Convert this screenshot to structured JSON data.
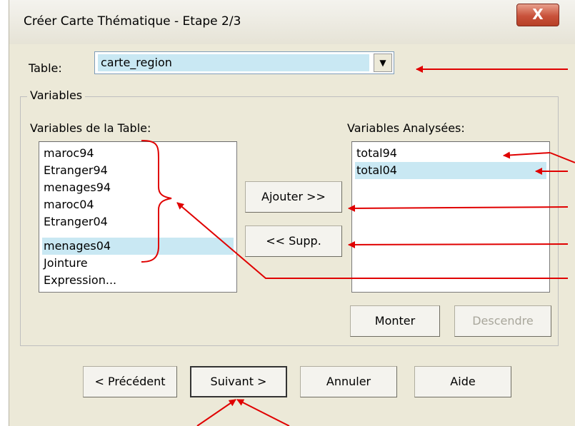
{
  "window": {
    "title": "Créer Carte Thématique - Etape 2/3",
    "close_label": "X"
  },
  "table": {
    "label": "Table:",
    "selected": "carte_region",
    "arrow": "▼"
  },
  "variables_group": {
    "legend": "Variables"
  },
  "source_list": {
    "label": "Variables de la Table:",
    "items": [
      "maroc94",
      "Etranger94",
      "menages94",
      "maroc04",
      "Etranger04",
      "menages04",
      "Jointure",
      "Expression..."
    ],
    "selected_index": 5
  },
  "target_list": {
    "label": "Variables Analysées:",
    "items": [
      "total94",
      "total04"
    ],
    "selected_index": 1
  },
  "buttons": {
    "add": "Ajouter >>",
    "remove": "<< Supp.",
    "up": "Monter",
    "down": "Descendre",
    "prev": "< Précédent",
    "next": "Suivant >",
    "cancel": "Annuler",
    "help": "Aide"
  },
  "colors": {
    "annotation": "#e00000",
    "selection": "#c9e8f3",
    "close_button": "#c9523b"
  }
}
